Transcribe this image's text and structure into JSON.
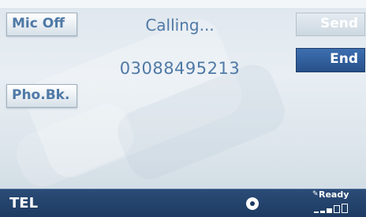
{
  "screen": {
    "title": "TEL"
  },
  "left_buttons": {
    "mic_off": "Mic Off",
    "phonebook": "Pho.Bk."
  },
  "right_buttons": {
    "send": "Send",
    "end": "End"
  },
  "call": {
    "status": "Calling...",
    "number": "03088495213"
  },
  "status_bar": {
    "ready": "Ready",
    "signal_level": 3,
    "signal_max": 5
  },
  "colors": {
    "accent_text": "#4f79a6",
    "bar_background": "#1d3a60",
    "end_button": "#2f5c99"
  },
  "icons": {
    "ready": "pen-icon",
    "knob": "rotary-knob-icon",
    "signal": "signal-strength-icon"
  }
}
